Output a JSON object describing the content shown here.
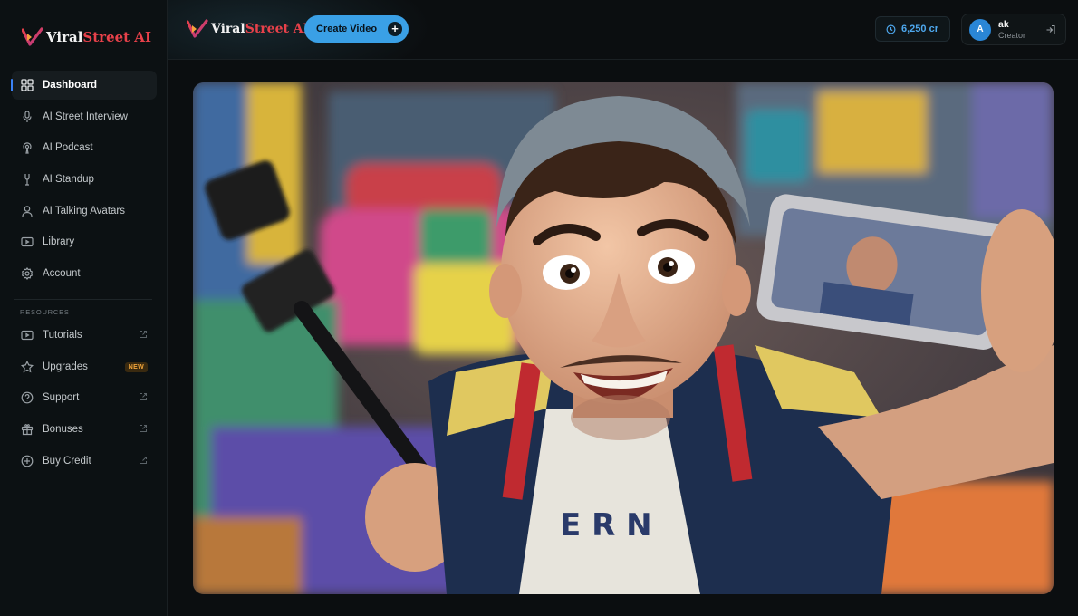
{
  "brand": {
    "name_part1": "Viral",
    "name_part2": "Street AI"
  },
  "sidebar": {
    "items": [
      {
        "label": "Dashboard",
        "icon": "grid-icon",
        "active": true
      },
      {
        "label": "AI Street Interview",
        "icon": "microphone-icon"
      },
      {
        "label": "AI Podcast",
        "icon": "podcast-icon"
      },
      {
        "label": "AI Standup",
        "icon": "stand-mic-icon"
      },
      {
        "label": "AI Talking Avatars",
        "icon": "user-icon"
      },
      {
        "label": "Library",
        "icon": "video-library-icon"
      },
      {
        "label": "Account",
        "icon": "gear-icon"
      }
    ],
    "resources_heading": "RESOURCES",
    "resources": [
      {
        "label": "Tutorials",
        "icon": "play-icon",
        "external": true
      },
      {
        "label": "Upgrades",
        "icon": "star-icon",
        "badge": "NEW"
      },
      {
        "label": "Support",
        "icon": "help-icon",
        "external": true
      },
      {
        "label": "Bonuses",
        "icon": "gift-icon",
        "external": true
      },
      {
        "label": "Buy Credit",
        "icon": "plus-circle-icon",
        "external": true
      }
    ]
  },
  "header": {
    "create_label": "Create Video",
    "credits": "6,250 cr",
    "user": {
      "initial": "A",
      "name": "ak",
      "role": "Creator"
    }
  },
  "colors": {
    "accent": "#3aa0e6",
    "brand_red": "#e8414a",
    "background": "#0b0e10"
  }
}
